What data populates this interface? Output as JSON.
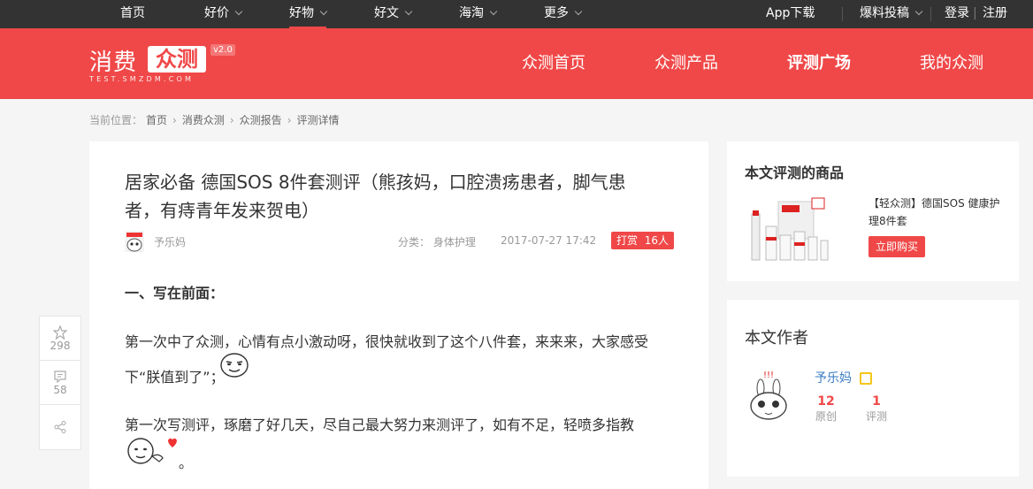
{
  "topbar": {
    "items": [
      {
        "label": "首页",
        "caret": false,
        "active": false
      },
      {
        "label": "好价",
        "caret": true,
        "active": false
      },
      {
        "label": "好物",
        "caret": true,
        "active": true
      },
      {
        "label": "好文",
        "caret": true,
        "active": false
      },
      {
        "label": "海淘",
        "caret": true,
        "active": false
      },
      {
        "label": "更多",
        "caret": true,
        "active": false
      }
    ],
    "app_download": "App下载",
    "submit": "爆料投稿",
    "login": "登录",
    "register": "注册"
  },
  "header": {
    "logo_text": "消费",
    "logo_box": "众测",
    "logo_version": "v2.0",
    "logo_url": "TEST.SMZDM.COM",
    "nav": [
      "众测首页",
      "众测产品",
      "评测广场",
      "我的众测"
    ]
  },
  "breadcrumb": {
    "label": "当前位置：",
    "items": [
      "首页",
      "消费众测",
      "众测报告",
      "评测详情"
    ]
  },
  "article": {
    "title": "居家必备 德国SOS 8件套测评（熊孩妈，口腔溃疡患者，脚气患者，有痔青年发来贺电）",
    "author": "予乐妈",
    "category": "分类：  身体护理",
    "date": "2017-07-27 17:42",
    "reward_label": "打赏",
    "reward_count": "16人",
    "section_heading": "一、写在前面：",
    "para1_line1": "第一次中了众测，心情有点小激动呀，很快就收到了这个八件套，来来来，大家感受",
    "para1_line2": "下“朕值到了”；",
    "para2_line1": "第一次写测评，琢磨了好几天，尽自己最大努力来测评了，如有不足，轻喷多指教",
    "para2_end": "。"
  },
  "side_toolbar": {
    "fav_count": "298",
    "comment_count": "58"
  },
  "product_card": {
    "title": "本文评测的商品",
    "name": "【轻众测】德国SOS 健康护理8件套",
    "buy_label": "立即购买"
  },
  "author_card": {
    "title": "本文作者",
    "name": "予乐妈",
    "original_count": "12",
    "original_label": "原创",
    "review_count": "1",
    "review_label": "评测"
  },
  "colors": {
    "brand_red": "#f04848",
    "topbar_bg": "#333333",
    "link_blue": "#3b7dc4"
  }
}
